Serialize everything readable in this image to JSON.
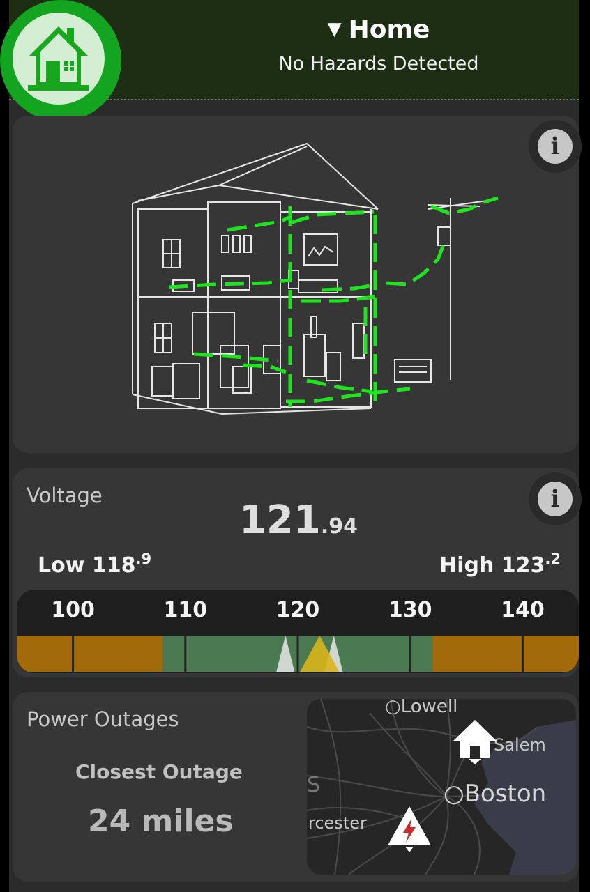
{
  "header": {
    "location_label": "Home",
    "status": "No Hazards Detected",
    "home_icon": "house-icon",
    "caret_icon": "triangle-down-icon"
  },
  "house_card": {
    "info_label": "i",
    "illustration": "house-wiring-illustration"
  },
  "voltage": {
    "label": "Voltage",
    "value_main": "121",
    "value_decimal": ".94",
    "low_label": "Low",
    "low_main": "118",
    "low_decimal": ".9",
    "high_label": "High",
    "high_main": "123",
    "high_decimal": ".2",
    "info_label": "i",
    "gauge": {
      "ticks": [
        "100",
        "110",
        "120",
        "130",
        "140"
      ],
      "min": 95,
      "max": 145,
      "normal_range": [
        108,
        132
      ],
      "current": 121.94,
      "low": 118.9,
      "high": 123.2,
      "colors": {
        "warning": "#a36a0a",
        "normal": "#4b7a52",
        "current": "#d9b51a",
        "marker": "#e8e8e8"
      }
    }
  },
  "outages": {
    "title": "Power Outages",
    "closest_label": "Closest Outage",
    "distance": "24 miles",
    "map": {
      "labels": {
        "lowell": "Lowell",
        "salem": "Salem",
        "boston": "Boston",
        "worcester": "rcester",
        "s_fragment": "S"
      },
      "home_icon": "house-marker-icon",
      "outage_icon": "lightning-warning-icon"
    }
  },
  "colors": {
    "header_bg": "#1d2e15",
    "badge_green": "#13a520",
    "wire_green": "#1fe31f",
    "card_bg": "#363636"
  }
}
